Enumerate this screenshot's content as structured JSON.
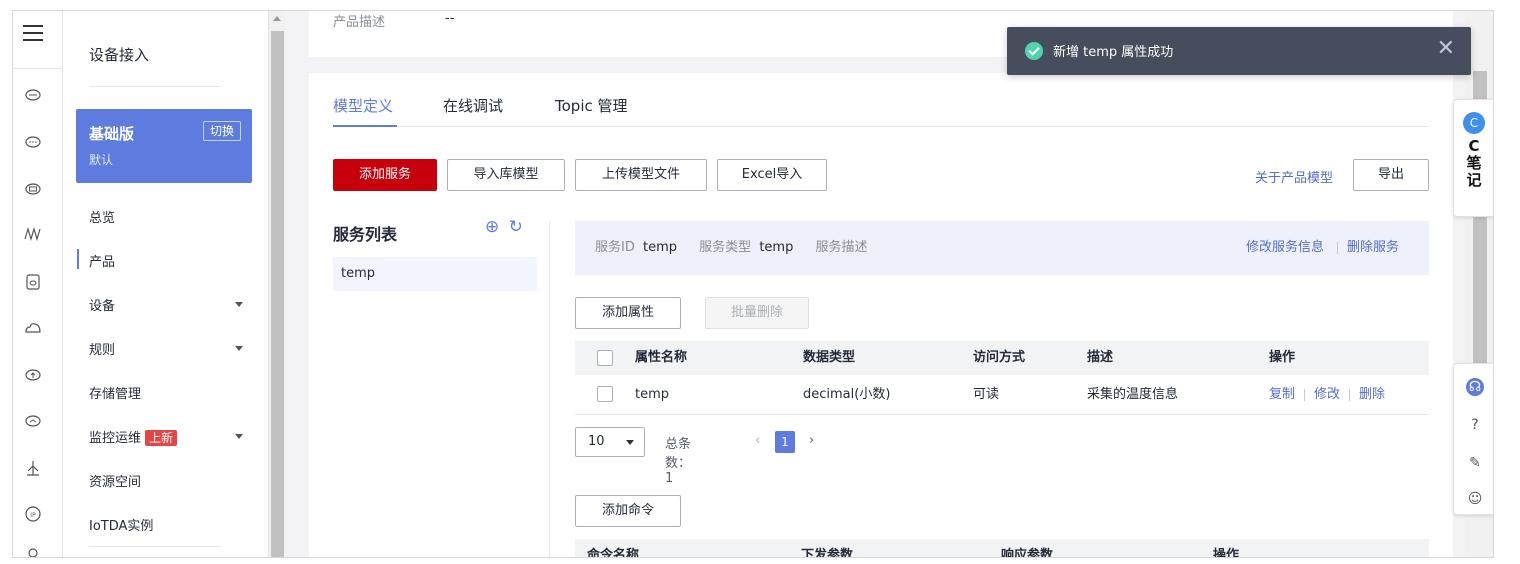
{
  "sidebar": {
    "title": "设备接入",
    "edition": {
      "name": "基础版",
      "sub": "默认",
      "switch_label": "切换"
    },
    "items": [
      {
        "label": "总览"
      },
      {
        "label": "产品"
      },
      {
        "label": "设备"
      },
      {
        "label": "规则"
      },
      {
        "label": "存储管理"
      },
      {
        "label": "监控运维",
        "badge": "上新"
      },
      {
        "label": "资源空间"
      },
      {
        "label": "IoTDA实例"
      }
    ]
  },
  "product": {
    "desc_label": "产品描述",
    "desc_value": "--"
  },
  "tabs": [
    {
      "label": "模型定义"
    },
    {
      "label": "在线调试"
    },
    {
      "label": "Topic 管理"
    }
  ],
  "toolbar": {
    "add_service": "添加服务",
    "import_library": "导入库模型",
    "upload_model": "上传模型文件",
    "excel_import": "Excel导入",
    "about_model": "关于产品模型",
    "export": "导出"
  },
  "service_list": {
    "title": "服务列表",
    "items": [
      {
        "name": "temp"
      }
    ]
  },
  "service_info": {
    "id_label": "服务ID",
    "id_value": "temp",
    "type_label": "服务类型",
    "type_value": "temp",
    "desc_label": "服务描述",
    "edit": "修改服务信息",
    "delete": "删除服务"
  },
  "properties": {
    "add_label": "添加属性",
    "batch_delete_label": "批量删除",
    "columns": [
      "属性名称",
      "数据类型",
      "访问方式",
      "描述",
      "操作"
    ],
    "rows": [
      {
        "name": "temp",
        "type": "decimal(小数)",
        "access": "可读",
        "desc": "采集的温度信息"
      }
    ],
    "actions": [
      "复制",
      "修改",
      "删除"
    ]
  },
  "pager": {
    "size": "10",
    "total": "总条数：1",
    "prev": "‹",
    "page": "1",
    "next": "›"
  },
  "commands": {
    "add_label": "添加命令",
    "columns": [
      "命令名称",
      "下发参数",
      "响应参数",
      "操作"
    ]
  },
  "note_widget": {
    "logo": "C",
    "line1": "C",
    "line2": "笔",
    "line3": "记"
  },
  "toast": {
    "message": "新增 temp 属性成功",
    "close": "✕"
  },
  "icons": {
    "menu": "hamburger-icon",
    "rail": [
      "cloud-device-icon",
      "cloud-chat-icon",
      "cloud-storage-icon",
      "waveform-icon",
      "cloud-box-icon",
      "cloud-outline-icon",
      "cloud-upload-icon",
      "cloud-gauge-icon",
      "satellite-icon",
      "ip-icon",
      "user-icon"
    ]
  },
  "colors": {
    "primary_red": "#c7000b",
    "accent_blue": "#5e7ce0",
    "link_blue": "#526ecc",
    "toast_bg": "#464d5c",
    "success_green": "#50d4ab"
  }
}
